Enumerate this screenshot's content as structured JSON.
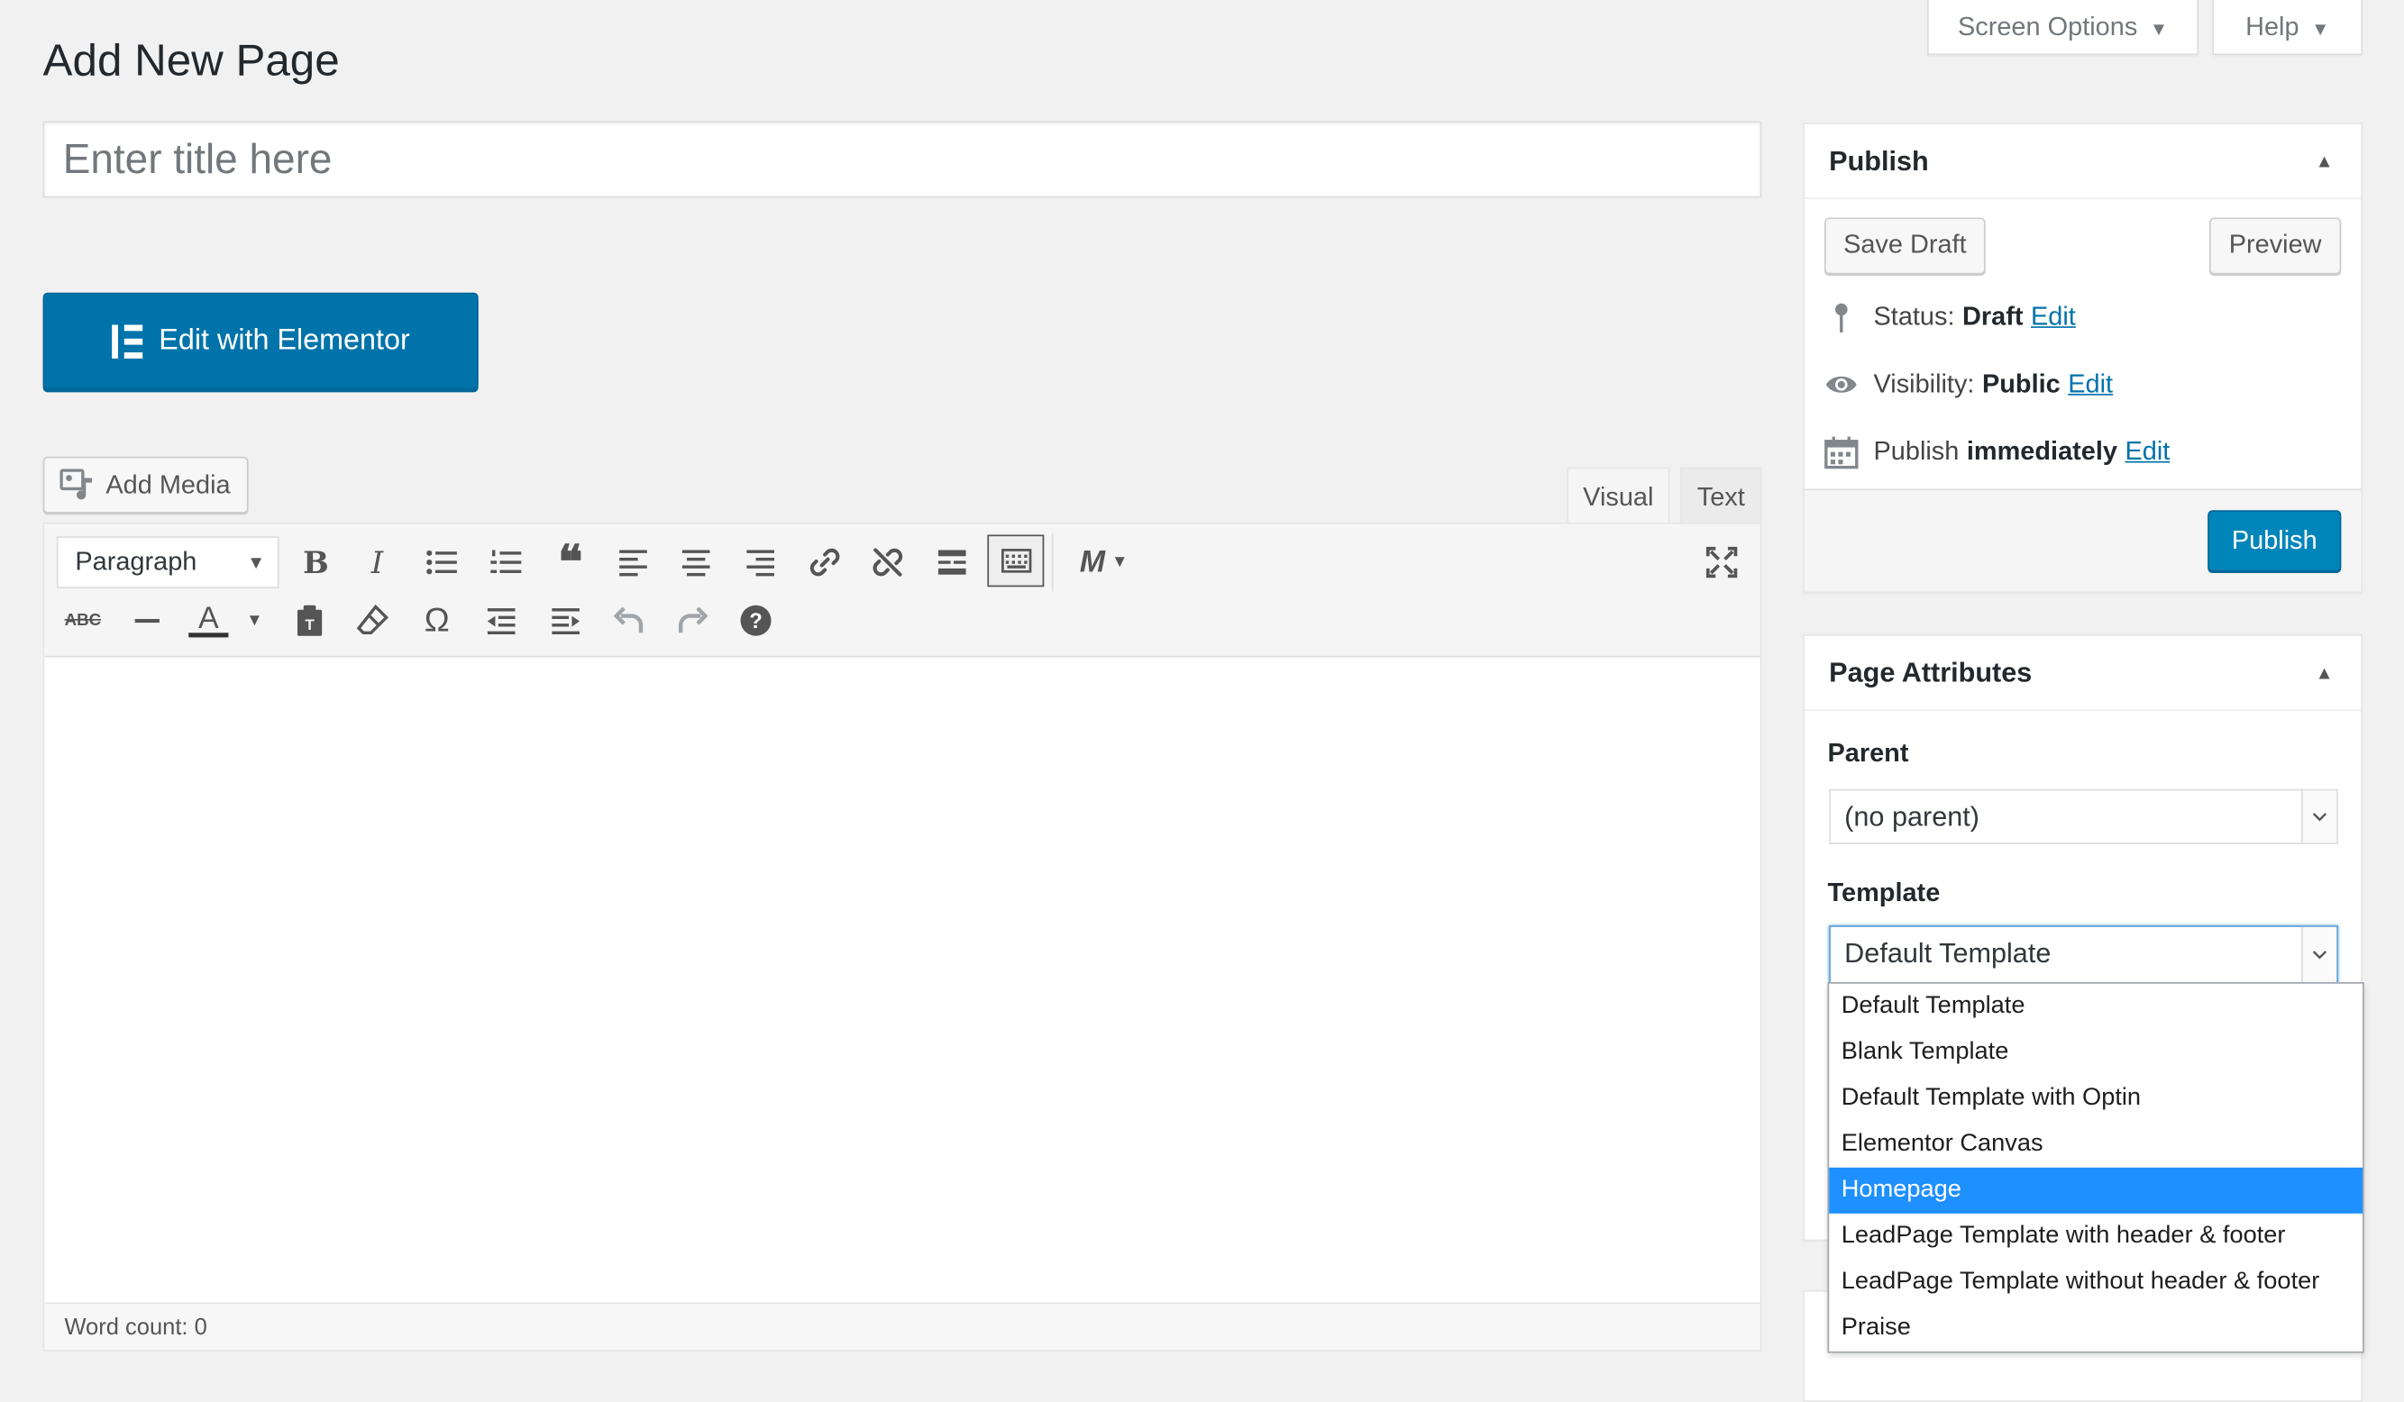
{
  "header": {
    "page_title": "Add New Page",
    "screen_options_label": "Screen Options",
    "help_label": "Help"
  },
  "title_field": {
    "placeholder": "Enter title here",
    "value": ""
  },
  "elementor": {
    "button_label": "Edit with Elementor"
  },
  "editor": {
    "add_media_label": "Add Media",
    "tab_visual": "Visual",
    "tab_text": "Text",
    "format_select": "Paragraph",
    "word_count": "Word count: 0",
    "toolbar_row1": [
      "bold-icon",
      "italic-icon",
      "bullet-list-icon",
      "numbered-list-icon",
      "blockquote-icon",
      "align-left-icon",
      "align-center-icon",
      "align-right-icon",
      "link-icon",
      "unlink-icon",
      "read-more-icon",
      "toolbar-toggle-icon",
      "m-plugin-icon"
    ],
    "toolbar_row2": [
      "strikethrough-icon",
      "horizontal-line-icon",
      "text-color-icon",
      "paste-text-icon",
      "clear-format-icon",
      "special-character-icon",
      "outdent-icon",
      "indent-icon",
      "undo-icon",
      "redo-icon",
      "help-icon"
    ]
  },
  "publish": {
    "title": "Publish",
    "save_draft_label": "Save Draft",
    "preview_label": "Preview",
    "status_label": "Status:",
    "status_value": "Draft",
    "visibility_label": "Visibility:",
    "visibility_value": "Public",
    "schedule_label": "Publish",
    "schedule_value": "immediately",
    "edit_link": "Edit",
    "publish_button": "Publish"
  },
  "page_attributes": {
    "title": "Page Attributes",
    "parent_label": "Parent",
    "parent_value": "(no parent)",
    "template_label": "Template",
    "template_value": "Default Template",
    "template_options": [
      "Default Template",
      "Blank Template",
      "Default Template with Optin",
      "Elementor Canvas",
      "Homepage",
      "LeadPage Template with header & footer",
      "LeadPage Template without header & footer",
      "Praise"
    ],
    "highlighted_option": "Homepage"
  },
  "colors": {
    "primary_blue": "#0073aa",
    "publish_blue": "#0085ba",
    "dropdown_highlight": "#1e90ff",
    "background": "#f1f1f1"
  }
}
